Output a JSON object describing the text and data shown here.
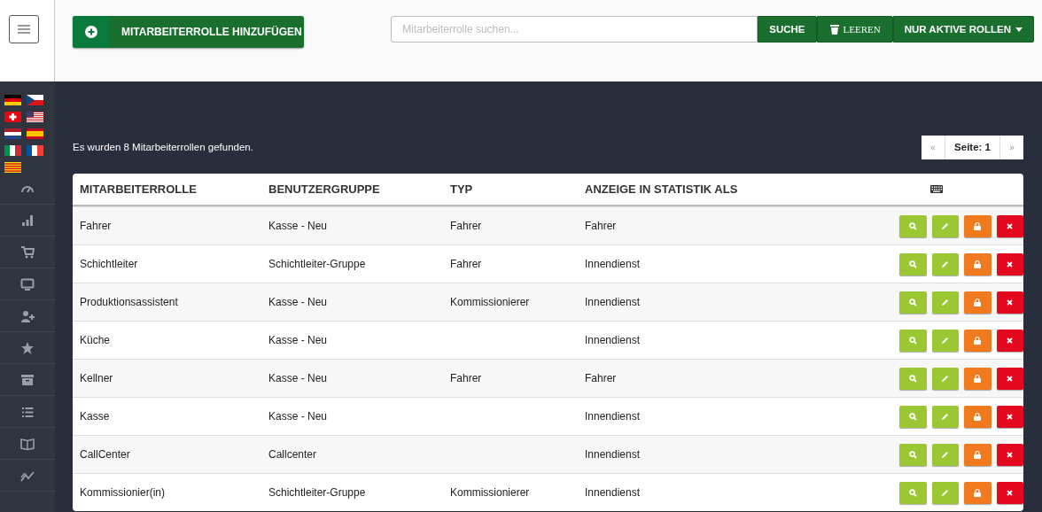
{
  "toolbar": {
    "add_button": "MITARBEITERROLLE HINZUFÜGEN",
    "search": {
      "placeholder": "Mitarbeiterrolle suchen..."
    },
    "search_button": "SUCHE",
    "clear_button": "LEEREN",
    "filter_button": "NUR AKTIVE ROLLEN"
  },
  "result_text": "Es wurden 8 Mitarbeiterrollen gefunden.",
  "pagination": {
    "prev": "«",
    "page": "Seite: 1",
    "next": "»"
  },
  "table": {
    "columns": [
      "MITARBEITERROLLE",
      "BENUTZERGRUPPE",
      "TYP",
      "ANZEIGE IN STATISTIK ALS"
    ],
    "rows": [
      {
        "role": "Fahrer",
        "group": "Kasse - Neu",
        "type": "Fahrer",
        "stat": "Fahrer"
      },
      {
        "role": "Schichtleiter",
        "group": "Schichtleiter-Gruppe",
        "type": "Fahrer",
        "stat": "Innendienst"
      },
      {
        "role": "Produktionsassistent",
        "group": "Kasse - Neu",
        "type": "Kommissionierer",
        "stat": "Innendienst"
      },
      {
        "role": "Küche",
        "group": "Kasse - Neu",
        "stat": "Innendienst"
      },
      {
        "role": "Kellner",
        "group": "Kasse - Neu",
        "type": "Fahrer",
        "stat": "Fahrer"
      },
      {
        "role": "Kasse",
        "group": "Kasse - Neu",
        "stat": "Innendienst"
      },
      {
        "role": "CallCenter",
        "group": "Callcenter",
        "stat": "Innendienst"
      },
      {
        "role": "Kommissionier(in)",
        "group": "Schichtleiter-Gruppe",
        "type": "Kommissionierer",
        "stat": "Innendienst"
      }
    ]
  }
}
